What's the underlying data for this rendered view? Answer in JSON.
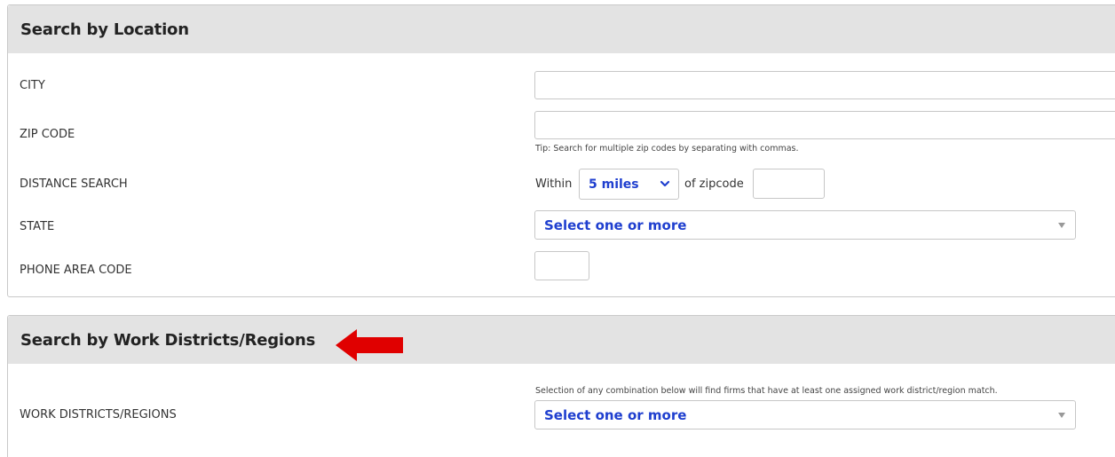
{
  "location_panel": {
    "title": "Search by Location",
    "city_label": "CITY",
    "city_value": "",
    "zip_label": "ZIP CODE",
    "zip_value": "",
    "zip_tip": "Tip: Search for multiple zip codes by separating with commas.",
    "distance_label": "DISTANCE SEARCH",
    "distance_within": "Within",
    "distance_selected": "5 miles",
    "distance_of_zipcode": "of zipcode",
    "distance_zip_value": "",
    "state_label": "STATE",
    "state_placeholder": "Select one or more",
    "area_code_label": "PHONE AREA CODE",
    "area_code_value": ""
  },
  "districts_panel": {
    "title": "Search by Work Districts/Regions",
    "districts_label": "WORK DISTRICTS/REGIONS",
    "districts_note": "Selection of any combination below will find firms that have at least one assigned work district/region match.",
    "districts_placeholder": "Select one or more"
  },
  "colors": {
    "header_bg": "#e3e3e3",
    "select_text": "#1f3fcf",
    "arrow": "#e00000",
    "border": "#c9c9c9"
  },
  "icons": {
    "distance_dropdown": "chevron-down-icon",
    "state_dropdown": "caret-down-icon",
    "districts_dropdown": "caret-down-icon",
    "annotation": "red-arrow-left-icon"
  }
}
